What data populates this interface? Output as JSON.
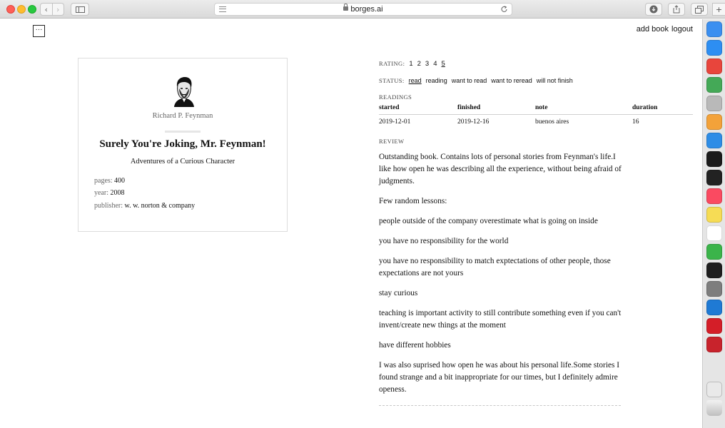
{
  "browser": {
    "url": "borges.ai",
    "back_glyph": "‹",
    "forward_glyph": "›"
  },
  "page": {
    "menu_glyph": "···",
    "nav_links": [
      "add book",
      "logout"
    ]
  },
  "book": {
    "author": "Richard P. Feynman",
    "title": "Surely You're Joking, Mr. Feynman!",
    "subtitle": "Adventures of a Curious Character",
    "pages_label": "pages:",
    "pages": "400",
    "year_label": "year:",
    "year": "2008",
    "publisher_label": "publisher:",
    "publisher": "w. w. norton & company"
  },
  "rating": {
    "label": "RATING:",
    "options": [
      "1",
      "2",
      "3",
      "4",
      "5"
    ],
    "selected": 5
  },
  "status": {
    "label": "STATUS:",
    "options": [
      "read",
      "reading",
      "want to read",
      "want to reread",
      "will not finish"
    ],
    "selected": "read"
  },
  "readings": {
    "label": "READINGS",
    "columns": [
      "started",
      "finished",
      "note",
      "duration"
    ],
    "rows": [
      [
        "2019-12-01",
        "2019-12-16",
        "buenos aires",
        "16"
      ]
    ]
  },
  "review": {
    "label": "REVIEW",
    "paragraphs": [
      "Outstanding book. Contains lots of personal stories from Feynman's life.I like how open he was describing all the experience, without being afraid of judgments.",
      "Few random lessons:",
      "people outside of the company overestimate what is going on inside",
      "you have no responsibility for the world",
      "you have no responsibility to match exptectations of other people, those expectations are not yours",
      "stay curious",
      "teaching is important activity to still contribute something even if you can't invent/create new things at the moment",
      "have different hobbies",
      "I was also suprised how open he was about his personal life.Some stories I found strange and a bit inappropriate for our times, but I definitely admire openess."
    ]
  },
  "dock": {
    "apps": [
      {
        "name": "finder-icon",
        "color": "#3b8ff0"
      },
      {
        "name": "safari-icon",
        "color": "#2d8ef2"
      },
      {
        "name": "chrome-icon",
        "color": "#e8453c"
      },
      {
        "name": "maps-icon",
        "color": "#44a957"
      },
      {
        "name": "keychain-icon",
        "color": "#b9b9b9"
      },
      {
        "name": "photos-icon",
        "color": "#f3a23a"
      },
      {
        "name": "mail-icon",
        "color": "#2e8de6"
      },
      {
        "name": "goland-icon",
        "color": "#1b1b1b"
      },
      {
        "name": "terminal-icon",
        "color": "#222222"
      },
      {
        "name": "music-icon",
        "color": "#fa4a61"
      },
      {
        "name": "notes-icon",
        "color": "#f6dc55"
      },
      {
        "name": "calendar-icon",
        "color": "#ffffff"
      },
      {
        "name": "xcode-icon",
        "color": "#3bb44a"
      },
      {
        "name": "activity-monitor-icon",
        "color": "#1e1e1e"
      },
      {
        "name": "system-preferences-icon",
        "color": "#7d7d7d"
      },
      {
        "name": "vscode-icon",
        "color": "#1f7ad4"
      },
      {
        "name": "lastfm-icon",
        "color": "#d41e28"
      },
      {
        "name": "speed-icon",
        "color": "#c8232c"
      }
    ]
  }
}
